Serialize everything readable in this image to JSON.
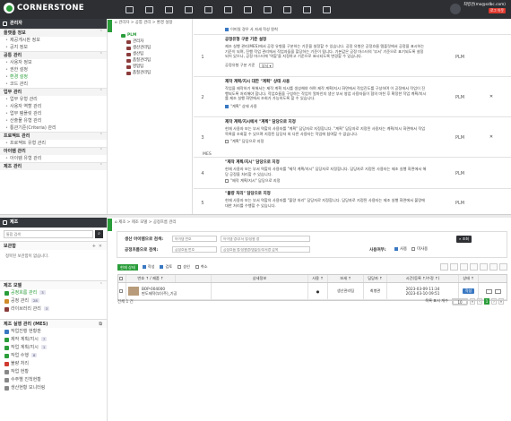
{
  "app": {
    "logo_text": "CORNERSTONE",
    "user_name": "최병관(mo@sdbc.com)",
    "user_badge": "로그 아웃"
  },
  "top_icons": [
    "grid-icon",
    "folder-icon",
    "doc-icon",
    "chart-icon",
    "box-icon",
    "tools-icon",
    "people-icon",
    "network-icon",
    "layers-icon",
    "monitor-icon",
    "cloud-icon"
  ],
  "admin_panel": {
    "title": "관리자",
    "groups": [
      {
        "label": "플랫폼 정보",
        "items": [
          "제공게시판 정보",
          "공지 정보"
        ]
      },
      {
        "label": "공통 관리",
        "items": [
          "사용자 정보",
          "권한 설정",
          "환경 설정",
          "코드 관리"
        ]
      },
      {
        "label": "업무 관리",
        "items": [
          "업무 유형 관리",
          "사용자 역할 관리",
          "업무 템플릿 관리",
          "산출물 유형 관리",
          "통관기준(Criteria) 관리"
        ]
      },
      {
        "label": "프로젝트 관리",
        "items": [
          "프로젝트 유형 관리"
        ]
      },
      {
        "label": "아이템 관리",
        "items": [
          "아이템 유형 관리"
        ]
      },
      {
        "label": "제조 관리",
        "items": []
      }
    ]
  },
  "breadcrumb_top": [
    "관리자",
    "공통 관리",
    "환경 설정"
  ],
  "tree": {
    "root": "PLM",
    "nodes": [
      "관리자",
      "생산관리팀",
      "생산팀",
      "품질관리팀",
      "영업팀",
      "품질관리팀"
    ]
  },
  "settings_rows": [
    {
      "num": "",
      "title": "",
      "body": "",
      "check_label": "이미일 경우 사 자세 작성 원칙",
      "checked": true,
      "plm": "",
      "x": ""
    },
    {
      "num": "1",
      "title": "공정유형 구분 기준 설정",
      "body": "제조 실행 관리(MES)에서 공정 유형을 구분하는 기준을 설정할 수 있습니다. 공정 유형은 공정흐름 템플릿에서 공정을 표시하는 기준이 되며, 진행 작업 관리에서 작업자들을 할당하는 기준이 됩니다. 기본값은 공정 마스터의 '부서' 기준으로 표기되도록 설정되어 있으나, 공정 마스터에 '역할'을 지정하고 기준으로 표시되도록 변경할 수 있습니다.",
      "select_label": "공정유형 구분 기준",
      "select_value": "부서",
      "plm": "PLM",
      "x": ""
    },
    {
      "num": "2",
      "title": "제작 계획/지시 대한 \"계획\" 상태 사용",
      "body": "작업을 제작하기 위해서는 제작 계획 지시를 생성해야 하며 제작 계획/지시 화면에서 작업진도를 구성하며 이 공정에서 작업이 진행되도록 처리해야 합니다. 작업흐름을 구성하는 작업이 얼마인지 생산 부서 영업 사용자들이 협의 마친 후 확정한 작업 계획/지시를 제조 실행 화면에서 조회가 가능하도록 할 수 있습니다.",
      "check_label": "\"계획\" 상태 사용",
      "checked": true,
      "plm": "PLM",
      "x": "✕"
    },
    {
      "num": "3",
      "title": "제작 계획/지시에서 \"계획\" 담당으로 지정",
      "body": "현재 사용자 또는 부서 역할의 사용자를 \"계획\" 담당자로 지정합니다. \"계획\" 담당자로 지정된 사용자는 계획/지시 화면에서 작업 목록을 조회할 수 있으며 지정된 담당자 외 다른 사용자는 작업에 참여할 수 없습니다.",
      "check_label": "\"계획\" 담당으로 지정",
      "checked": false,
      "plm": "PLM",
      "x": "✕"
    },
    {
      "num": "4",
      "title": "\"제작 계획/지시\" 담당으로 지정",
      "body": "현재 사용자 또는 부서 역할의 사용자를 \"제작 계획/지시\" 담당자로 지정합니다. 담당자로 지정된 사용자는 제조 실행 화면에서 해당 공정을 처리할 수 있습니다.",
      "check_label": "\"제작 계획/지시\" 담당으로 지정",
      "checked": false,
      "plm": "PLM",
      "x": ""
    },
    {
      "num": "5",
      "title": "\"불량 처리\" 담당으로 지정",
      "body": "현재 사용자 또는 부서 역할의 사용자를 \"불량 처리\" 담당자로 지정합니다. 담당자로 지정된 사용자는 제조 실행 화면에서 불량에 대한 처리를 수행할 수 있습니다.",
      "check_label": "",
      "checked": false,
      "plm": "PLM",
      "x": ""
    }
  ],
  "mes_label": "MES",
  "mfg_panel": {
    "title": "제조",
    "search_placeholder": "통합 검색",
    "bookmark": {
      "label": "보관함",
      "empty": "정복된 보관함이 없습니다."
    },
    "template": {
      "label": "제조 모델",
      "items": [
        {
          "label": "공정흐름 관리",
          "count": "3"
        },
        {
          "label": "공정 관리",
          "count": "28"
        },
        {
          "label": "라이브러리 관리",
          "count": "3"
        }
      ]
    },
    "mes": {
      "label": "제조 실행 관리 (MES)",
      "items": [
        "작업진행 현황판",
        "제작 계획/지시",
        "작업 계획/지시",
        "작업 수행",
        "불량 처리",
        "작업 현황",
        "수주별 진척현황",
        "생산현황 모니터링"
      ],
      "counts": [
        "",
        "7",
        "1",
        "8",
        "",
        "",
        "",
        ""
      ]
    }
  },
  "breadcrumb_bottom": [
    "제조",
    "제조 모델",
    "공정흐름 관리"
  ],
  "form": {
    "label1": "생산 아이템으로 검색:",
    "placeholder1a": "아이템 번호",
    "placeholder1b": "아이템 명/부서 명/정렬 명",
    "label2": "공정흐름으로 검색:",
    "placeholder2a": "공정흐름 번호",
    "placeholder2b": "공정흐름 명/정렬명/템플릿/부서명 검색",
    "use_label": "사용여부:",
    "use_options": [
      "사용",
      "미사용"
    ],
    "search_button": "조회"
  },
  "tabs": {
    "selected": "현재 상태",
    "options": [
      "작성",
      "검토",
      "승인",
      "취소"
    ]
  },
  "grid": {
    "headers": [
      "",
      "번호 ↑ / 제품 ↑",
      "",
      "상세정보",
      "사용 ↑",
      "보세 ↑",
      "담당자 ↑",
      "시간(등록 ↑/수정 ↑)",
      "상태 ↑",
      ""
    ],
    "rows": [
      {
        "number": "BOP-004000",
        "name": "판도제작(부)(주)_기공",
        "use": "●",
        "dept": "생산관리팀",
        "owner": "최병관",
        "created": "2023-03-09 11:34",
        "modified": "2023-03-10 09:51",
        "state": "작성"
      }
    ],
    "total": "전체 1 건",
    "per_page_label": "목록 표시 개수",
    "per_page": "10",
    "page": "1"
  },
  "colors": {
    "accent": "#2a9d3a",
    "topbar": "#2d2f33",
    "state": "#3a78c2"
  }
}
